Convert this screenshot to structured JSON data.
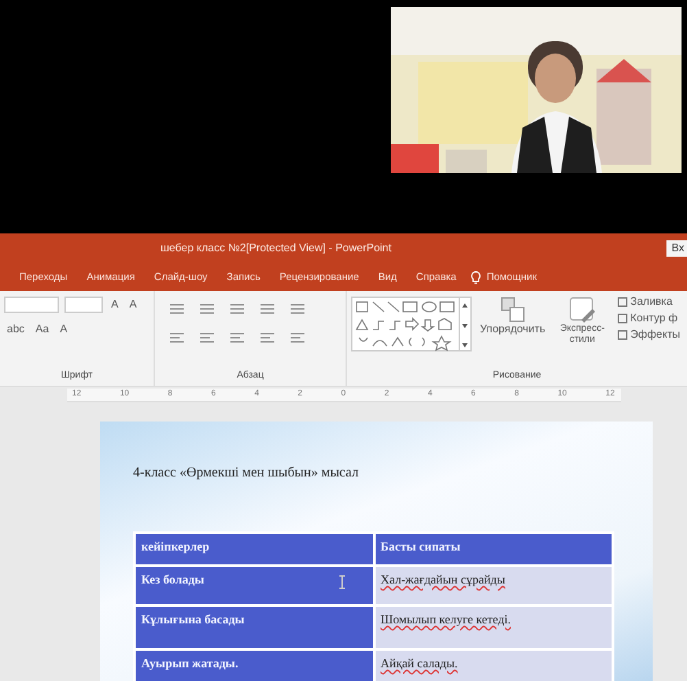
{
  "window": {
    "title": "шебер класс №2[Protected View]  -  PowerPoint",
    "account_button": "Вх"
  },
  "ribbon_tabs": [
    {
      "label": "Переходы",
      "selected": false
    },
    {
      "label": "Анимация",
      "selected": false
    },
    {
      "label": "Слайд-шоу",
      "selected": false
    },
    {
      "label": "Запись",
      "selected": false
    },
    {
      "label": "Рецензирование",
      "selected": false
    },
    {
      "label": "Вид",
      "selected": false
    },
    {
      "label": "Справка",
      "selected": false
    }
  ],
  "tell_me": "Помощник",
  "font_group": {
    "row_1": [
      "A",
      "A"
    ],
    "row_2": [
      "abc",
      "Aa",
      "A"
    ],
    "label": "Шрифт"
  },
  "paragraph_group": {
    "label": "Абзац"
  },
  "drawing_group": {
    "label": "Рисование",
    "arrange": "Упорядочить",
    "quick_styles": "Экспресс-стили",
    "shape_options": [
      "Заливка",
      "Контур ф",
      "Эффекты"
    ]
  },
  "ruler": [
    "12",
    "10",
    "8",
    "6",
    "4",
    "2",
    "0",
    "2",
    "4",
    "6",
    "8",
    "10",
    "12"
  ],
  "slide": {
    "title": "4-класс «Өрмекші мен шыбын» мысал",
    "table": {
      "columns": [
        "кейіпкерлер",
        "Басты сипаты"
      ],
      "rows": [
        [
          "Кез болады",
          "Хал-жағдайын сұрайды"
        ],
        [
          "Кұлығына басады",
          "Шомылып келуге кетеді."
        ],
        [
          "Ауырып жатады.",
          "Айқай салады."
        ]
      ]
    }
  }
}
